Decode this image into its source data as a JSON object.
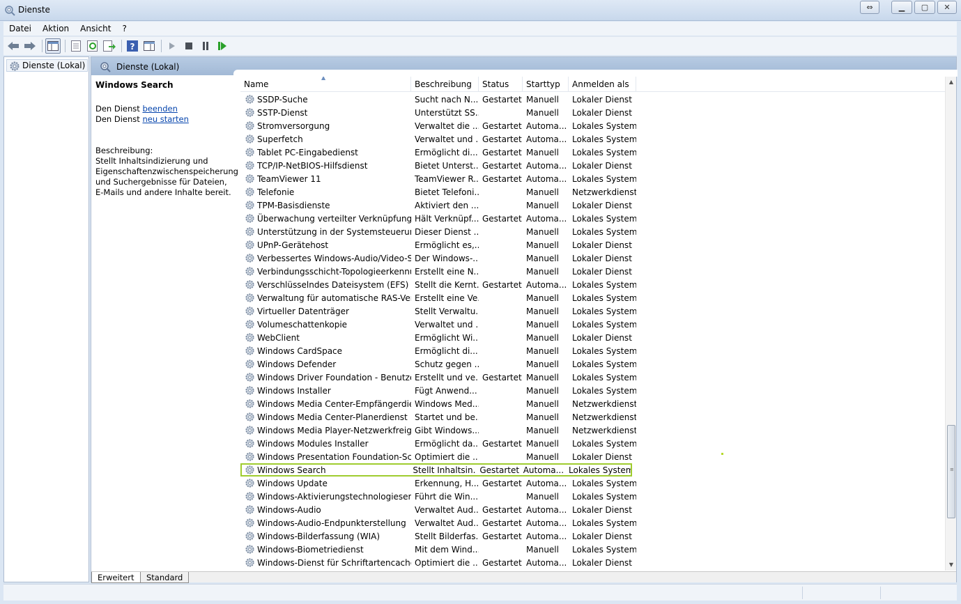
{
  "window": {
    "title": "Dienste"
  },
  "menu": [
    "Datei",
    "Aktion",
    "Ansicht",
    "?"
  ],
  "toolbar": {
    "buttons": [
      "back-icon",
      "forward-icon",
      "show-console-tree-icon",
      "properties-icon",
      "refresh-icon",
      "export-list-icon",
      "help-icon",
      "action-pane-icon",
      "start-service-icon",
      "stop-service-icon",
      "pause-service-icon",
      "restart-service-icon"
    ]
  },
  "tree": {
    "root_label": "Dienste (Lokal)"
  },
  "pane": {
    "header_title": "Dienste (Lokal)",
    "selected_service": "Windows Search",
    "action_prefix": "Den Dienst",
    "action_stop": "beenden",
    "action_restart": "neu starten",
    "description_label": "Beschreibung:",
    "description_text": "Stellt Inhaltsindizierung und Eigenschaftenzwischenspeicherung und Suchergebnisse für Dateien, E-Mails und andere Inhalte bereit."
  },
  "table": {
    "columns": [
      "Name",
      "Beschreibung",
      "Status",
      "Starttyp",
      "Anmelden als"
    ],
    "rows": [
      [
        "SSDP-Suche",
        "Sucht nach N...",
        "Gestartet",
        "Manuell",
        "Lokaler Dienst"
      ],
      [
        "SSTP-Dienst",
        "Unterstützt SS...",
        "",
        "Manuell",
        "Lokaler Dienst"
      ],
      [
        "Stromversorgung",
        "Verwaltet die ...",
        "Gestartet",
        "Automa...",
        "Lokales System"
      ],
      [
        "Superfetch",
        "Verwaltet und ...",
        "Gestartet",
        "Automa...",
        "Lokales System"
      ],
      [
        "Tablet PC-Eingabedienst",
        "Ermöglicht di...",
        "Gestartet",
        "Manuell",
        "Lokales System"
      ],
      [
        "TCP/IP-NetBIOS-Hilfsdienst",
        "Bietet Unterst...",
        "Gestartet",
        "Automa...",
        "Lokaler Dienst"
      ],
      [
        "TeamViewer 11",
        "TeamViewer R...",
        "Gestartet",
        "Automa...",
        "Lokales System"
      ],
      [
        "Telefonie",
        "Bietet Telefoni...",
        "",
        "Manuell",
        "Netzwerkdienst"
      ],
      [
        "TPM-Basisdienste",
        "Aktiviert den ...",
        "",
        "Manuell",
        "Lokaler Dienst"
      ],
      [
        "Überwachung verteilter Verknüpfungen ...",
        "Hält Verknüpf...",
        "Gestartet",
        "Automa...",
        "Lokales System"
      ],
      [
        "Unterstützung in der Systemsteuerung u...",
        "Dieser Dienst ...",
        "",
        "Manuell",
        "Lokales System"
      ],
      [
        "UPnP-Gerätehost",
        "Ermöglicht es,...",
        "",
        "Manuell",
        "Lokaler Dienst"
      ],
      [
        "Verbessertes Windows-Audio/Video-Str...",
        "Der Windows-...",
        "",
        "Manuell",
        "Lokaler Dienst"
      ],
      [
        "Verbindungsschicht-Topologieerkennu...",
        "Erstellt eine N...",
        "",
        "Manuell",
        "Lokaler Dienst"
      ],
      [
        "Verschlüsselndes Dateisystem (EFS)",
        "Stellt die Kernt...",
        "Gestartet",
        "Automa...",
        "Lokales System"
      ],
      [
        "Verwaltung für automatische RAS-Verbi...",
        "Erstellt eine Ve...",
        "",
        "Manuell",
        "Lokales System"
      ],
      [
        "Virtueller Datenträger",
        "Stellt Verwaltu...",
        "",
        "Manuell",
        "Lokales System"
      ],
      [
        "Volumeschattenkopie",
        "Verwaltet und ...",
        "",
        "Manuell",
        "Lokales System"
      ],
      [
        "WebClient",
        "Ermöglicht Wi...",
        "",
        "Manuell",
        "Lokaler Dienst"
      ],
      [
        "Windows CardSpace",
        "Ermöglicht di...",
        "",
        "Manuell",
        "Lokales System"
      ],
      [
        "Windows Defender",
        "Schutz gegen ...",
        "",
        "Manuell",
        "Lokales System"
      ],
      [
        "Windows Driver Foundation - Benutzer...",
        "Erstellt und ve...",
        "Gestartet",
        "Manuell",
        "Lokales System"
      ],
      [
        "Windows Installer",
        "Fügt Anwend...",
        "",
        "Manuell",
        "Lokales System"
      ],
      [
        "Windows Media Center-Empfängerdienst",
        "Windows Med...",
        "",
        "Manuell",
        "Netzwerkdienst"
      ],
      [
        "Windows Media Center-Planerdienst",
        "Startet und be...",
        "",
        "Manuell",
        "Netzwerkdienst"
      ],
      [
        "Windows Media Player-Netzwerkfreigab...",
        "Gibt Windows...",
        "",
        "Manuell",
        "Netzwerkdienst"
      ],
      [
        "Windows Modules Installer",
        "Ermöglicht da...",
        "Gestartet",
        "Manuell",
        "Lokales System"
      ],
      [
        "Windows Presentation Foundation-Schr...",
        "Optimiert die ...",
        "",
        "Manuell",
        "Lokaler Dienst"
      ],
      [
        "Windows Search",
        "Stellt Inhaltsin...",
        "Gestartet",
        "Automa...",
        "Lokales System"
      ],
      [
        "Windows Update",
        "Erkennung, H...",
        "Gestartet",
        "Automa...",
        "Lokales System"
      ],
      [
        "Windows-Aktivierungstechnologieservice",
        "Führt die Win...",
        "",
        "Manuell",
        "Lokales System"
      ],
      [
        "Windows-Audio",
        "Verwaltet Aud...",
        "Gestartet",
        "Automa...",
        "Lokaler Dienst"
      ],
      [
        "Windows-Audio-Endpunkterstellung",
        "Verwaltet Aud...",
        "Gestartet",
        "Automa...",
        "Lokales System"
      ],
      [
        "Windows-Bilderfassung (WIA)",
        "Stellt Bilderfas...",
        "Gestartet",
        "Automa...",
        "Lokaler Dienst"
      ],
      [
        "Windows-Biometriedienst",
        "Mit dem Wind...",
        "",
        "Manuell",
        "Lokales System"
      ],
      [
        "Windows-Dienst für Schriftartencache",
        "Optimiert die ...",
        "Gestartet",
        "Automa...",
        "Lokaler Dienst"
      ]
    ],
    "selected_row_index": 28
  },
  "tabs": {
    "extended": "Erweitert",
    "standard": "Standard"
  },
  "colors": {
    "selection_outline": "#9fcc2e",
    "link": "#0645ad"
  }
}
